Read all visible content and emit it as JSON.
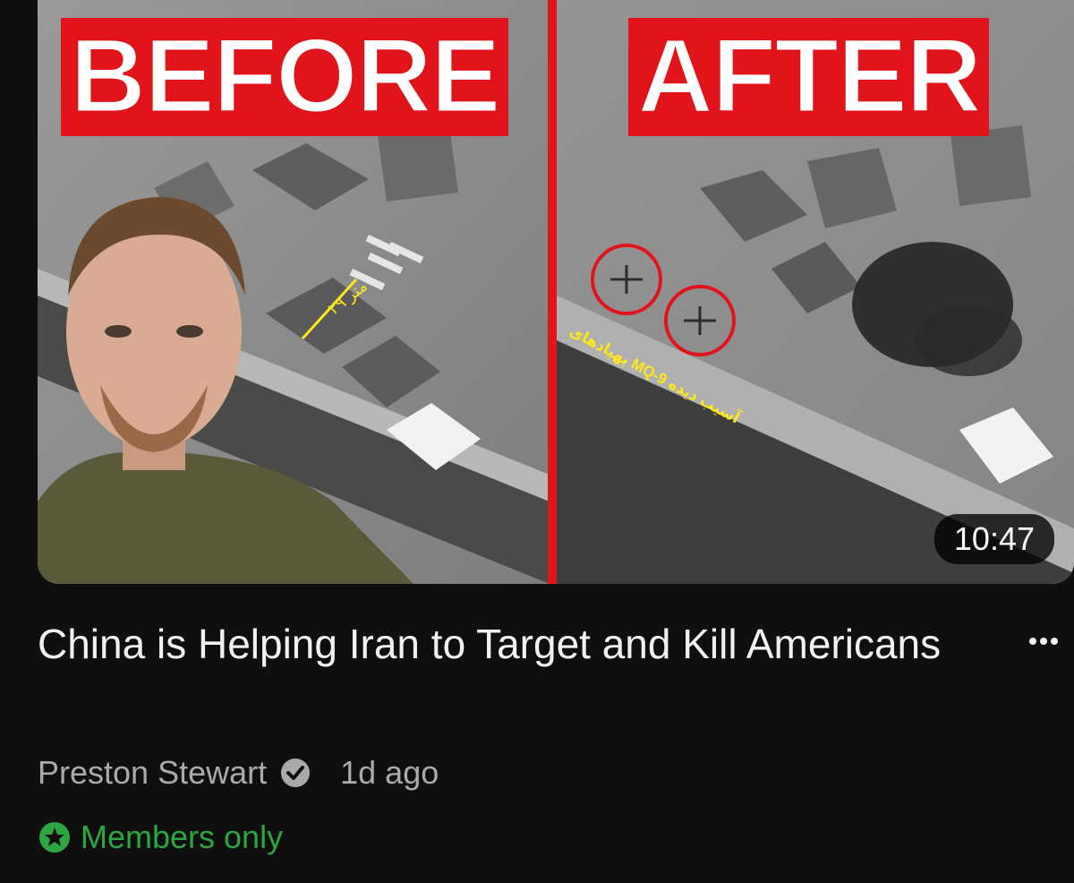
{
  "video": {
    "thumbnail": {
      "before_label": "BEFORE",
      "after_label": "AFTER",
      "duration": "10:47",
      "measure_label": "۲۹ متر",
      "annotation": "پهپادهای MQ-9 آسیب دیده",
      "accent_color": "#e1141c"
    },
    "title": "China is Helping Iran to Target and Kill Americans",
    "channel": "Preston Stewart",
    "verified_icon": "verified-check-icon",
    "age": "1d ago",
    "members_label": "Members only",
    "members_icon": "star-badge-icon",
    "members_color": "#2ba640",
    "more_icon": "more-vert-icon"
  }
}
